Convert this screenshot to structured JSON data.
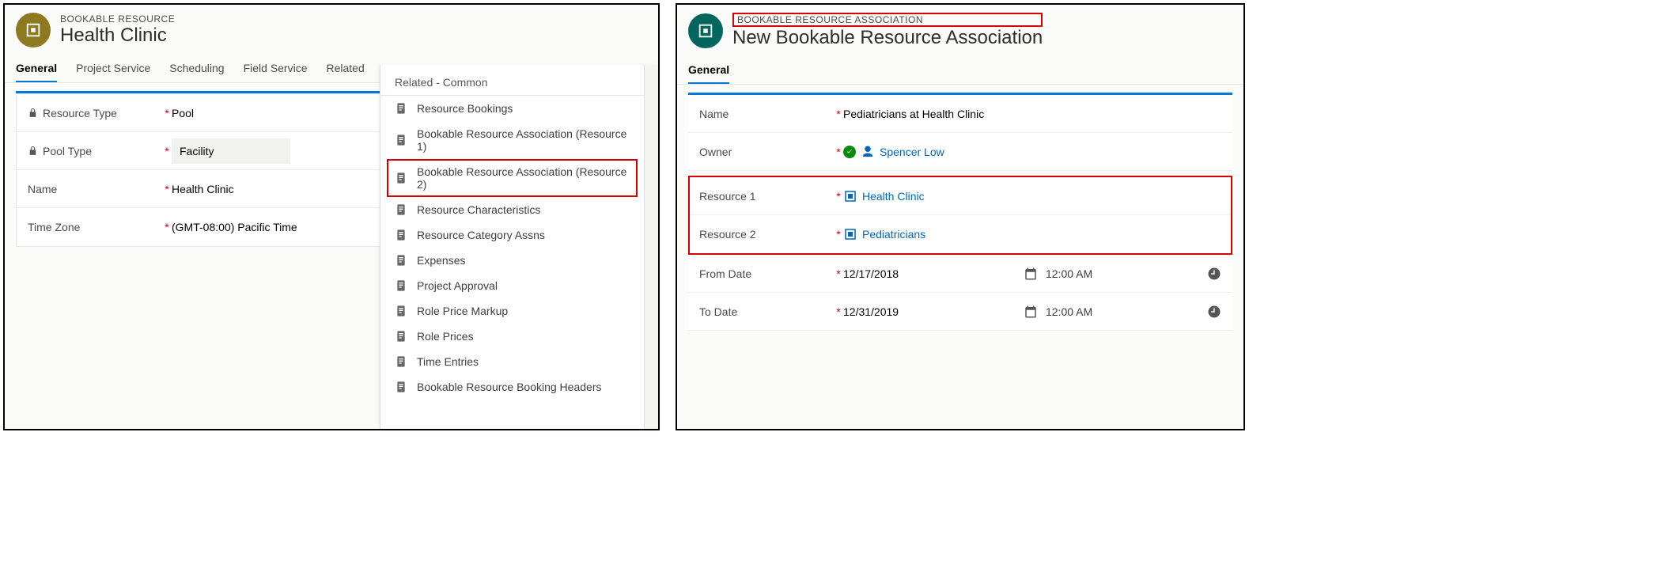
{
  "left": {
    "entity_label": "BOOKABLE RESOURCE",
    "title": "Health Clinic",
    "tabs": [
      "General",
      "Project Service",
      "Scheduling",
      "Field Service",
      "Related"
    ],
    "fields": {
      "resource_type": {
        "label": "Resource Type",
        "value": "Pool",
        "locked": true
      },
      "pool_type": {
        "label": "Pool Type",
        "value": "Facility",
        "locked": true
      },
      "name": {
        "label": "Name",
        "value": "Health Clinic"
      },
      "time_zone": {
        "label": "Time Zone",
        "value": "(GMT-08:00) Pacific Time"
      }
    },
    "related": {
      "heading": "Related - Common",
      "items": [
        "Resource Bookings",
        "Bookable Resource Association (Resource 1)",
        "Bookable Resource Association (Resource 2)",
        "Resource Characteristics",
        "Resource Category Assns",
        "Expenses",
        "Project Approval",
        "Role Price Markup",
        "Role Prices",
        "Time Entries",
        "Bookable Resource Booking Headers"
      ],
      "highlight_index": 2
    }
  },
  "right": {
    "entity_label": "BOOKABLE RESOURCE ASSOCIATION",
    "title": "New Bookable Resource Association",
    "section": "General",
    "fields": {
      "name": {
        "label": "Name",
        "value": "Pediatricians at Health Clinic"
      },
      "owner": {
        "label": "Owner",
        "value": "Spencer Low"
      },
      "resource1": {
        "label": "Resource 1",
        "value": "Health Clinic"
      },
      "resource2": {
        "label": "Resource 2",
        "value": "Pediatricians"
      },
      "from_date": {
        "label": "From Date",
        "date": "12/17/2018",
        "time": "12:00 AM"
      },
      "to_date": {
        "label": "To Date",
        "date": "12/31/2019",
        "time": "12:00 AM"
      }
    }
  }
}
